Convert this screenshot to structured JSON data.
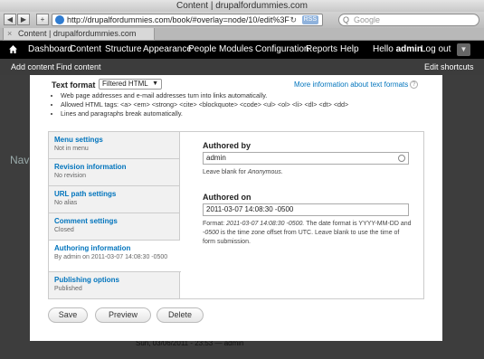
{
  "window": {
    "title": "Content | drupalfordummies.com"
  },
  "browser": {
    "url": "http://drupalfordummies.com/book/#overlay=node/10/edit%3Fdestination%3I",
    "rss": "RSS",
    "search_placeholder": "Google",
    "tab_label": "Content | drupalfordummies.com",
    "back_glyph": "◀",
    "forward_glyph": "▶",
    "add_glyph": "+"
  },
  "admin_bar": {
    "items": [
      "Dashboard",
      "Content",
      "Structure",
      "Appearance",
      "People",
      "Modules",
      "Configuration",
      "Reports",
      "Help"
    ],
    "hello_prefix": "Hello",
    "user": "admin",
    "logout": "Log out"
  },
  "shortcut_bar": {
    "add_content": "Add content",
    "find_content": "Find content",
    "edit_shortcuts": "Edit shortcuts"
  },
  "background": {
    "nav_stub": "Nav",
    "footer": "Sun, 03/06/2011 - 23:53 — admin"
  },
  "text_format": {
    "label": "Text format",
    "selected": "Filtered HTML",
    "more_info": "More information about text formats",
    "tips": [
      "Web page addresses and e-mail addresses turn into links automatically.",
      "Allowed HTML tags: <a> <em> <strong> <cite> <blockquote> <code> <ul> <ol> <li> <dl> <dt> <dd>",
      "Lines and paragraphs break automatically."
    ]
  },
  "vertical_tabs": [
    {
      "title": "Menu settings",
      "summary": "Not in menu"
    },
    {
      "title": "Revision information",
      "summary": "No revision"
    },
    {
      "title": "URL path settings",
      "summary": "No alias"
    },
    {
      "title": "Comment settings",
      "summary": "Closed"
    },
    {
      "title": "Authoring information",
      "summary": "By admin on 2011-03-07 14:08:30 -0500"
    },
    {
      "title": "Publishing options",
      "summary": "Published"
    }
  ],
  "authoring": {
    "authored_by_label": "Authored by",
    "authored_by_value": "admin",
    "authored_by_help_prefix": "Leave blank for",
    "authored_by_help_em": "Anonymous.",
    "authored_on_label": "Authored on",
    "authored_on_value": "2011-03-07  14:08:30  -0500",
    "help_format": "Format:",
    "help_format_em": "2011-03-07 14:08:30 -0500.",
    "help_2": "The date format is YYYY-MM-DD and",
    "help_em2": "-0500",
    "help_3": "is the time zone offset from UTC. Leave blank to use the time of form submission."
  },
  "buttons": {
    "save": "Save",
    "preview": "Preview",
    "delete": "Delete"
  }
}
